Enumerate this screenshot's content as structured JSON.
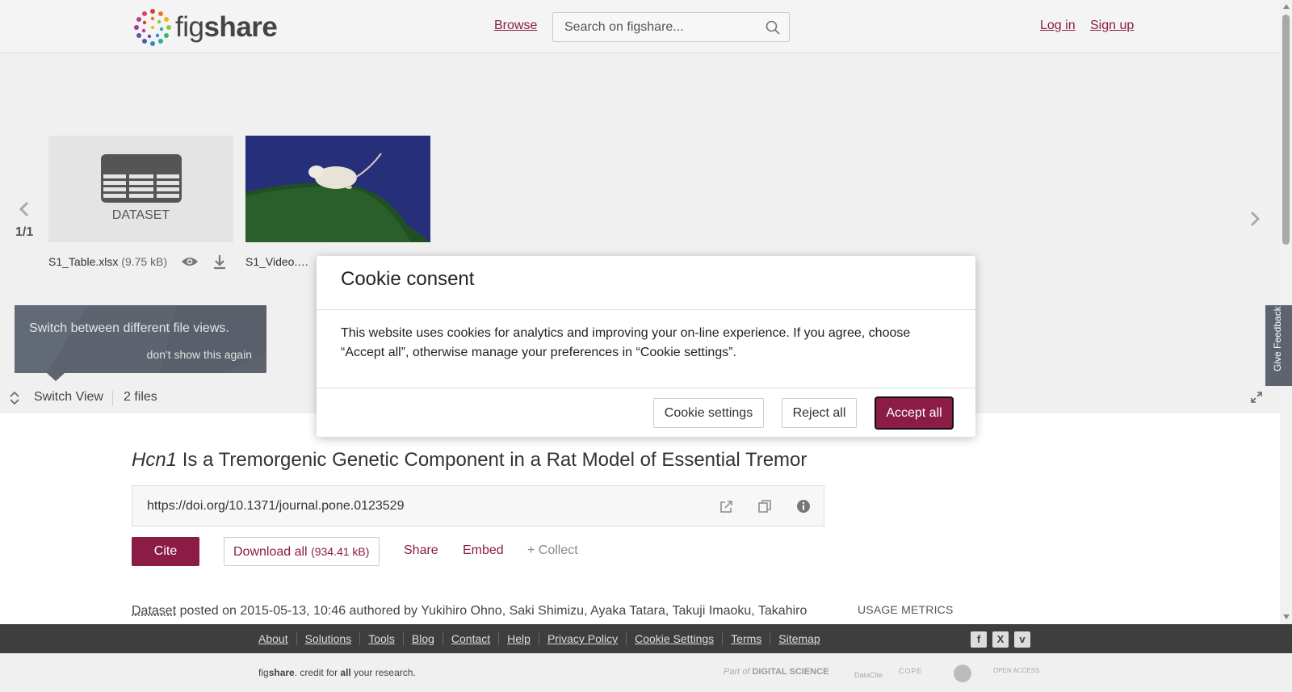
{
  "header": {
    "logo_word_light": "fig",
    "logo_word_bold": "share",
    "browse": "Browse",
    "search_placeholder": "Search on figshare...",
    "login": "Log in",
    "signup": "Sign up"
  },
  "viewer": {
    "pager": "1/1",
    "file1_thumb_label": "DATASET",
    "file1_name": "S1_Table.xlsx",
    "file1_size": "(9.75 kB)",
    "file2_name": "S1_Video.…",
    "tooltip_text": "Switch between different file views.",
    "tooltip_dismiss": "don't show this again",
    "switch_view": "Switch View",
    "files_count": "2 files"
  },
  "feedback": "Give Feedback",
  "item": {
    "title_italic": "Hcn1",
    "title_rest": " Is a Tremorgenic Genetic Component in a Rat Model of Essential Tremor",
    "doi": "https://doi.org/10.1371/journal.pone.0123529",
    "cite": "Cite",
    "download_all": "Download all ",
    "download_size": "(934.41 kB)",
    "share": "Share",
    "embed": "Embed",
    "collect": "+ Collect",
    "type": "Dataset",
    "posted_text": " posted on 2015-05-13, 10:46 authored by Yukihiro Ohno, Saki Shimizu, Ayaka Tatara, Takuji Imaoku, Takahiro",
    "usage_metrics": "USAGE METRICS"
  },
  "footer": {
    "links": [
      "About",
      "Solutions",
      "Tools",
      "Blog",
      "Contact",
      "Help",
      "Privacy Policy",
      "Cookie Settings",
      "Terms",
      "Sitemap"
    ],
    "tagline_fig": "fig",
    "tagline_share": "share",
    "tagline_mid": ". credit for ",
    "tagline_all": "all",
    "tagline_end": " your research.",
    "partner_ds_prefix": "Part of",
    "partner_ds": "DIGITAL SCIENCE",
    "partner_datacite": "DataCite",
    "partner_cope": "COPE",
    "partner_oa": "OPEN ACCESS"
  },
  "cookie_modal": {
    "title": "Cookie consent",
    "body": "This website uses cookies for analytics and improving your on-line experience. If you agree, choose “Accept all”, otherwise manage your preferences in “Cookie settings”.",
    "settings_button": "Cookie settings",
    "reject_button": "Reject all",
    "accept_button": "Accept all"
  },
  "colors": {
    "brand": "#8a1c46",
    "tooltip": "#5d6470",
    "footer_dark": "#3e3e3e"
  }
}
